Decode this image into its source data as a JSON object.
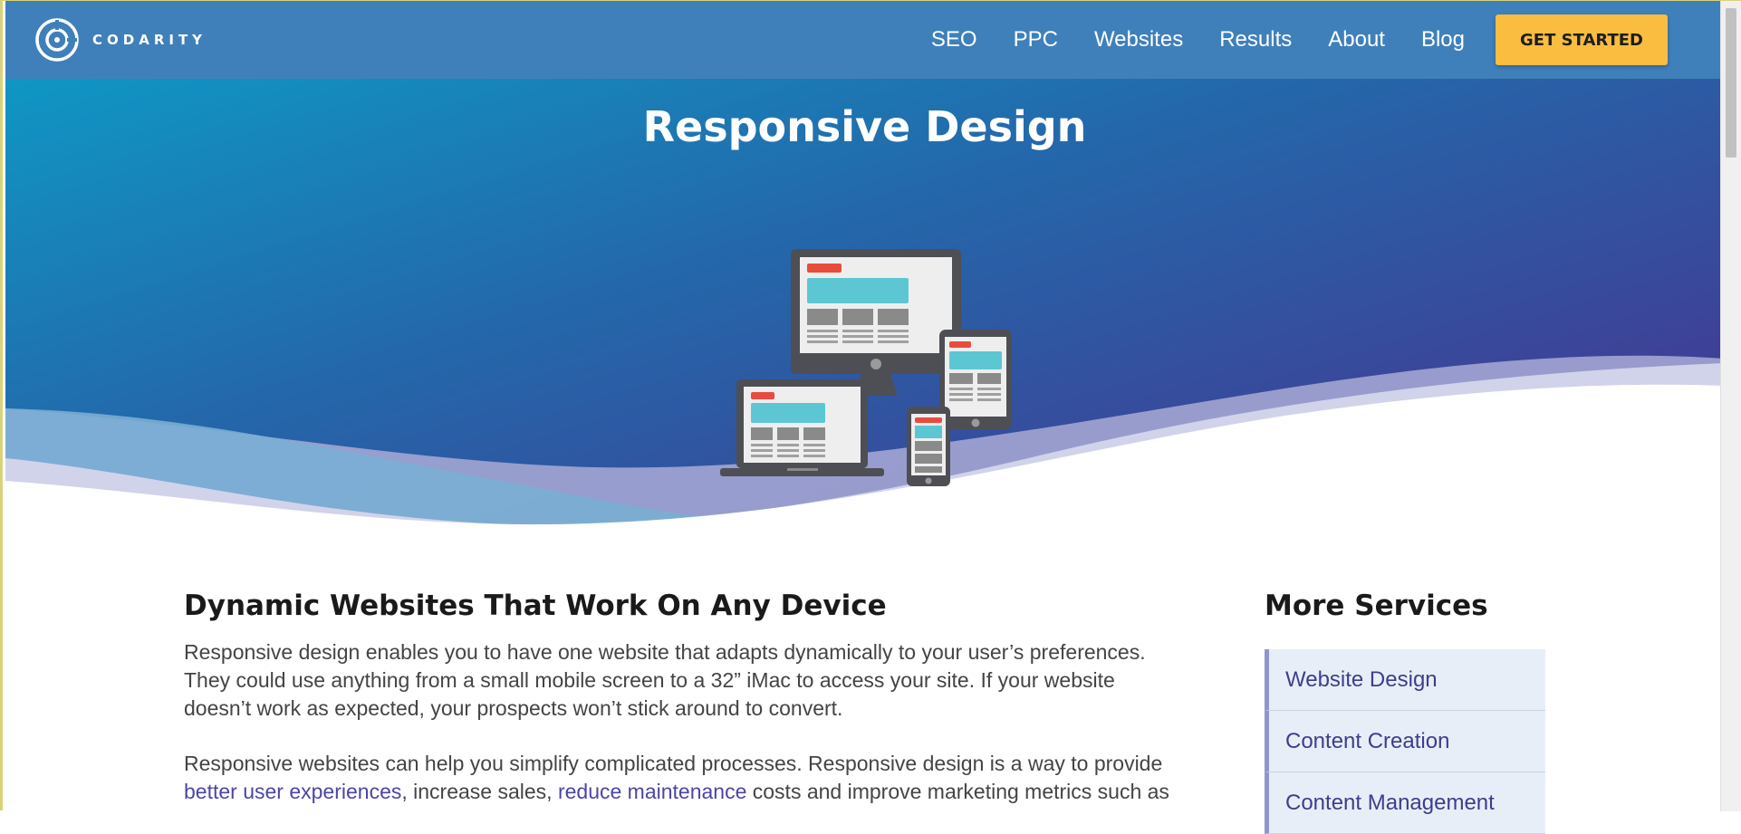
{
  "brand": {
    "name": "CODARITY"
  },
  "nav": {
    "links": [
      "SEO",
      "PPC",
      "Websites",
      "Results",
      "About",
      "Blog"
    ],
    "cta_label": "GET STARTED"
  },
  "hero": {
    "title": "Responsive Design"
  },
  "main": {
    "heading": "Dynamic Websites That Work On Any Device",
    "paragraph1": "Responsive design enables you to have one website that adapts dynamically to your user’s preferences. They could use anything from a small mobile screen to a 32” iMac to access your site. If your website doesn’t work as expected, your prospects won’t stick around to convert.",
    "paragraph2_start": "Responsive websites can help you simplify complicated processes. Responsive design is a way to provide",
    "link1": "better user experiences",
    "paragraph2_mid": ", increase sales,",
    "link2": "reduce maintenance",
    "paragraph2_end": "costs and improve marketing metrics such as"
  },
  "sidebar": {
    "heading": "More Services",
    "items": [
      "Website Design",
      "Content Creation",
      "Content Management"
    ]
  },
  "colors": {
    "nav_bg": "#3f80bb",
    "cta_bg": "#fbbd3f",
    "link": "#4a46a6",
    "sidebar_item_bg": "#e8eef7",
    "sidebar_accent": "#8e96d0"
  },
  "icons": [
    "codarity-logo-icon",
    "desktop-monitor-icon",
    "laptop-icon",
    "tablet-icon",
    "phone-icon"
  ]
}
